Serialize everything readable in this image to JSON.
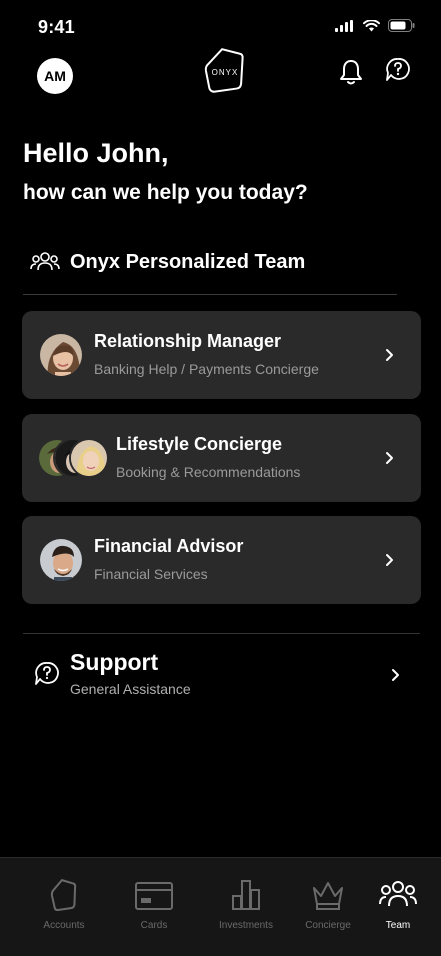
{
  "status_bar": {
    "time": "9:41"
  },
  "header": {
    "avatar_initials": "AM",
    "logo_text": "ONYX"
  },
  "greeting": {
    "title": "Hello John,",
    "subtitle": "how can we help you today?"
  },
  "team_section": {
    "title": "Onyx Personalized Team"
  },
  "team_cards": [
    {
      "title": "Relationship Manager",
      "subtitle": "Banking Help / Payments Concierge"
    },
    {
      "title": "Lifestyle Concierge",
      "subtitle": "Booking & Recommendations"
    },
    {
      "title": "Financial Advisor",
      "subtitle": "Financial Services"
    }
  ],
  "support": {
    "title": "Support",
    "subtitle": "General Assistance"
  },
  "bottom_nav": {
    "tabs": [
      {
        "label": "Accounts",
        "icon": "shield-icon",
        "active": false
      },
      {
        "label": "Cards",
        "icon": "card-icon",
        "active": false
      },
      {
        "label": "Investments",
        "icon": "bar-chart-icon",
        "active": false
      },
      {
        "label": "Concierge",
        "icon": "crown-icon",
        "active": false
      },
      {
        "label": "Team",
        "icon": "team-icon",
        "active": true
      }
    ]
  },
  "colors": {
    "background": "#000000",
    "card": "#2a2a2a",
    "muted_text": "#9a9a9a",
    "inactive_tab": "#6a6a6a",
    "nav_bg": "#161616"
  }
}
